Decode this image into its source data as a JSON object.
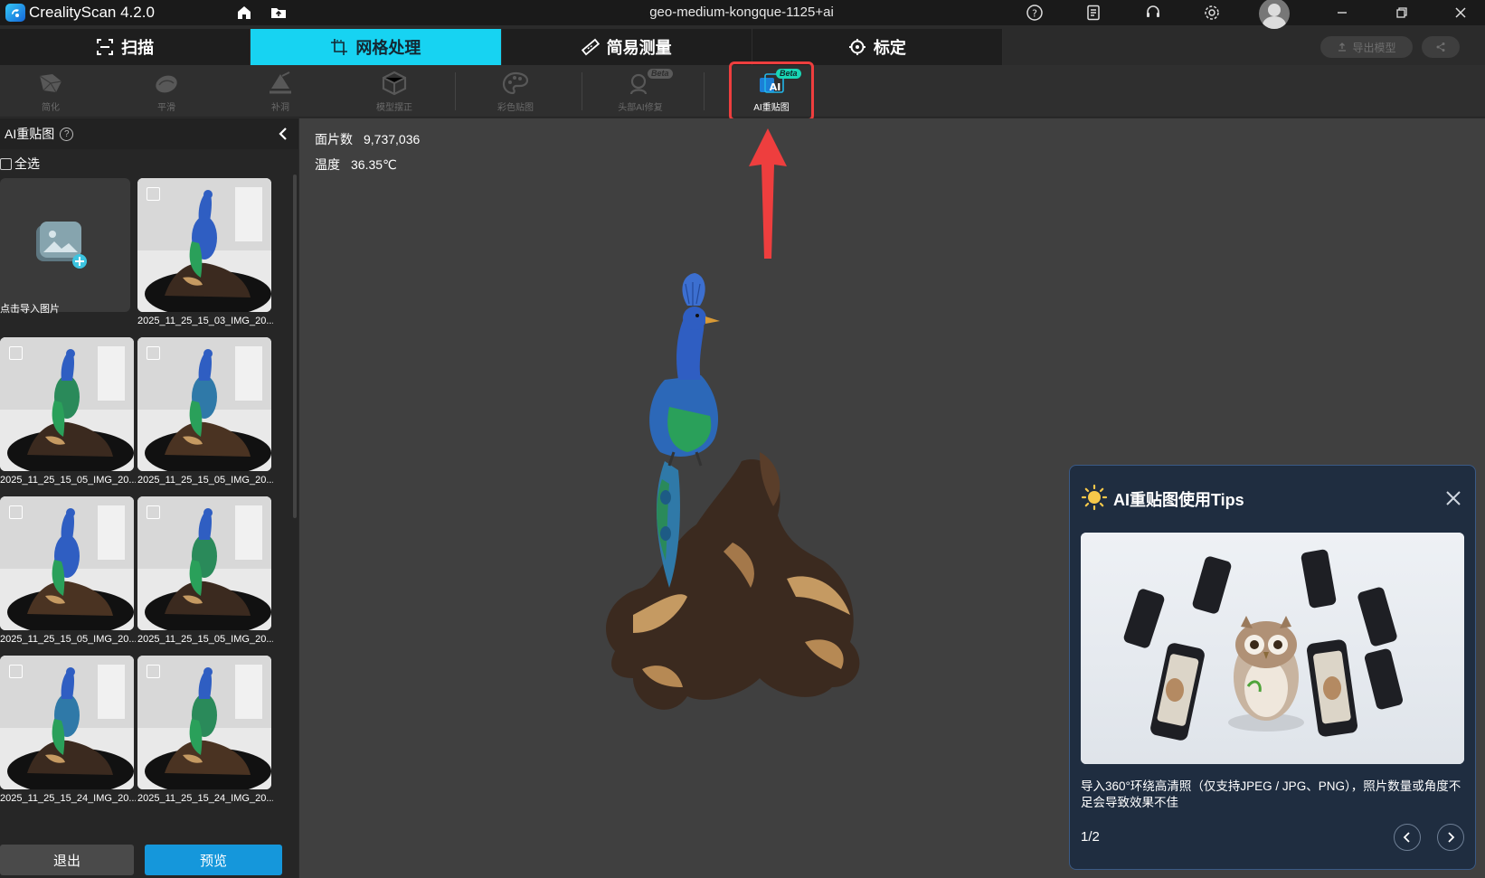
{
  "app": {
    "name": "CrealityScan 4.2.0",
    "window_title": "geo-medium-kongque-1125+ai"
  },
  "main_tabs": [
    {
      "label": "扫描",
      "icon": "scan-icon"
    },
    {
      "label": "网格处理",
      "icon": "crop-icon",
      "active": true
    },
    {
      "label": "简易测量",
      "icon": "ruler-icon"
    },
    {
      "label": "标定",
      "icon": "crosshair-icon"
    }
  ],
  "header_actions": {
    "export_label": "导出模型",
    "share_icon": "share-icon"
  },
  "toolbar": {
    "tools": [
      {
        "label": "简化",
        "icon": "simplify-icon"
      },
      {
        "label": "平滑",
        "icon": "smooth-icon"
      },
      {
        "label": "补洞",
        "icon": "fill-hole-icon"
      },
      {
        "label": "模型摆正",
        "icon": "align-model-icon"
      },
      {
        "label": "彩色贴图",
        "icon": "palette-icon"
      },
      {
        "label": "头部AI修复",
        "icon": "head-ai-repair-icon",
        "badge": "Beta"
      },
      {
        "label": "AI重贴图",
        "icon": "ai-retexture-icon",
        "badge": "Beta",
        "active": true
      }
    ],
    "badge_ai": "AI"
  },
  "left_panel": {
    "title": "AI重贴图",
    "help_symbol": "?",
    "select_all_label": "全选",
    "import_label": "点击导入图片",
    "thumbnails": [
      "2025_11_25_15_03_IMG_20...",
      "2025_11_25_15_05_IMG_20...",
      "2025_11_25_15_05_IMG_20...",
      "2025_11_25_15_05_IMG_20...",
      "2025_11_25_15_05_IMG_20...",
      "2025_11_25_15_24_IMG_20...",
      "2025_11_25_15_24_IMG_20..."
    ],
    "exit_label": "退出",
    "preview_label": "预览"
  },
  "viewport": {
    "faces_label": "面片数",
    "faces_value": "9,737,036",
    "temp_label": "温度",
    "temp_value": "36.35℃"
  },
  "tips": {
    "title": "AI重贴图使用Tips",
    "text": "导入360°环绕高清照（仅支持JPEG / JPG、PNG），照片数量或角度不足会导致效果不佳",
    "page": "1/2"
  },
  "colors": {
    "accent": "#17d3f2",
    "primary_button": "#1597db",
    "highlight": "#ee3e3e",
    "tips_bg": "#1f2d40"
  }
}
